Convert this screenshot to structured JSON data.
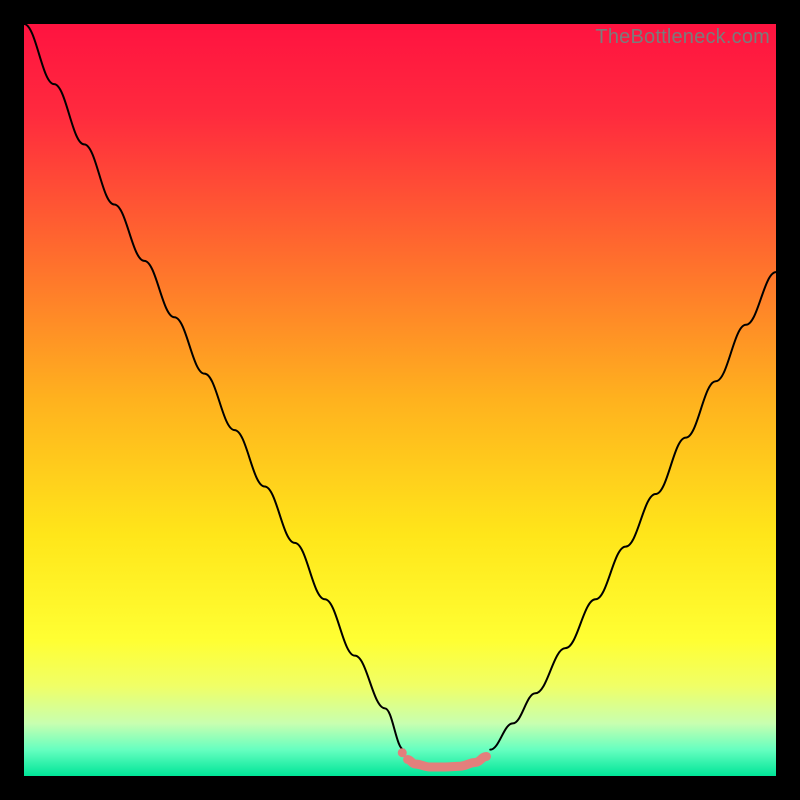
{
  "watermark": "TheBottleneck.com",
  "chart_data": {
    "type": "line",
    "title": "",
    "xlabel": "",
    "ylabel": "",
    "xlim": [
      0,
      100
    ],
    "ylim": [
      0,
      100
    ],
    "gradient_stops": [
      {
        "offset": 0.0,
        "color": "#ff1340"
      },
      {
        "offset": 0.12,
        "color": "#ff2a3e"
      },
      {
        "offset": 0.3,
        "color": "#ff6a2e"
      },
      {
        "offset": 0.5,
        "color": "#ffb21e"
      },
      {
        "offset": 0.68,
        "color": "#ffe61a"
      },
      {
        "offset": 0.82,
        "color": "#ffff33"
      },
      {
        "offset": 0.88,
        "color": "#f0ff66"
      },
      {
        "offset": 0.93,
        "color": "#c8ffb0"
      },
      {
        "offset": 0.965,
        "color": "#66ffc0"
      },
      {
        "offset": 1.0,
        "color": "#00e598"
      }
    ],
    "series": [
      {
        "name": "left-branch",
        "color": "#000000",
        "width": 2,
        "x": [
          0,
          4,
          8,
          12,
          16,
          20,
          24,
          28,
          32,
          36,
          40,
          44,
          48,
          50.5
        ],
        "y": [
          100,
          92,
          84,
          76,
          68.5,
          61,
          53.5,
          46,
          38.5,
          31,
          23.5,
          16,
          9,
          3.5
        ]
      },
      {
        "name": "right-branch",
        "color": "#000000",
        "width": 2,
        "x": [
          62,
          65,
          68,
          72,
          76,
          80,
          84,
          88,
          92,
          96,
          100
        ],
        "y": [
          3.5,
          7,
          11,
          17,
          23.5,
          30.5,
          37.5,
          45,
          52.5,
          60,
          67
        ]
      },
      {
        "name": "trough-band",
        "color": "#e37f7c",
        "width": 9,
        "x": [
          51,
          52,
          54,
          56,
          58,
          60,
          61.5
        ],
        "y": [
          2.2,
          1.6,
          1.2,
          1.2,
          1.3,
          1.8,
          2.6
        ]
      }
    ],
    "markers": [
      {
        "name": "trough-start-dot",
        "x": 50.3,
        "y": 3.1,
        "r": 4.5,
        "color": "#e37f7c"
      }
    ]
  }
}
